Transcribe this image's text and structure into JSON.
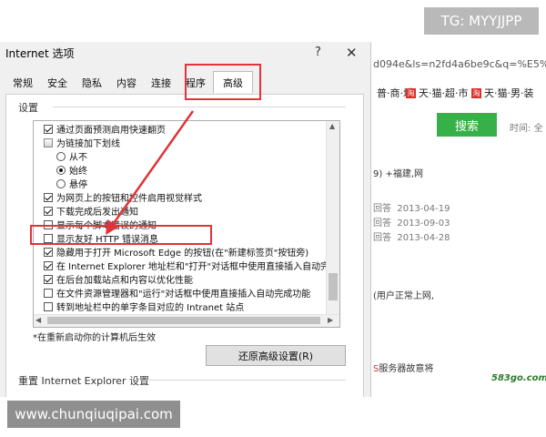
{
  "watermark_top": "TG: MYYJJPP",
  "watermark_bottom": "www.chunqiuqipai.com",
  "browser": {
    "address": "d094e&ls=n2fd4a6be9c&q=%E5%B8%",
    "bookmarks": [
      "普·商·城",
      "天·猫·超·市",
      "天·猫·男·装"
    ],
    "bookmark_badge": "淘",
    "search_button": "搜索",
    "time_label": "时间:",
    "time_value": "全",
    "result_snippet": "9) +福建,网",
    "answers": [
      {
        "label": "回答",
        "date": "2013-04-19"
      },
      {
        "label": "回答",
        "date": "2013-09-03"
      },
      {
        "label": "回答",
        "date": "2013-04-28"
      }
    ],
    "snippet2": "(用户正常上网,",
    "snippet3_prefix": "S",
    "snippet3": "服务器故意将",
    "site": "583go.com"
  },
  "dialog": {
    "title": "Internet 选项",
    "help": "?",
    "close": "✕",
    "tabs": [
      "常规",
      "安全",
      "隐私",
      "内容",
      "连接",
      "程序",
      "高级"
    ],
    "settings_label": "设置",
    "items": [
      {
        "type": "checkbox",
        "checked": true,
        "label": "通过页面预测启用快速翻页"
      },
      {
        "type": "group",
        "label": "为链接加下划线"
      },
      {
        "type": "radio",
        "checked": false,
        "label": "从不"
      },
      {
        "type": "radio",
        "checked": true,
        "label": "始终"
      },
      {
        "type": "radio",
        "checked": false,
        "label": "悬停"
      },
      {
        "type": "checkbox",
        "checked": true,
        "label": "为网页上的按钮和控件启用视觉样式"
      },
      {
        "type": "checkbox",
        "checked": true,
        "label": "下载完成后发出通知"
      },
      {
        "type": "checkbox",
        "checked": false,
        "label": "显示每个脚本错误的通知"
      },
      {
        "type": "checkbox",
        "checked": false,
        "label": "显示友好 HTTP 错误消息"
      },
      {
        "type": "checkbox",
        "checked": true,
        "label": "隐藏用于打开 Microsoft Edge 的按钮(在\"新建标签页\"按钮旁)"
      },
      {
        "type": "checkbox",
        "checked": true,
        "label": "在 Internet Explorer 地址栏和\"打开\"对话框中使用直接插入自动完"
      },
      {
        "type": "checkbox",
        "checked": true,
        "label": "在后台加载站点和内容以优化性能"
      },
      {
        "type": "checkbox",
        "checked": false,
        "label": "在文件资源管理器和\"运行\"对话框中使用直接插入自动完成功能"
      },
      {
        "type": "checkbox",
        "checked": false,
        "label": "转到地址栏中的单字条目对应的 Intranet 站点"
      }
    ],
    "note": "*在重新启动你的计算机后生效",
    "restore_button": "还原高级设置(R)",
    "reset_label": "重置 Internet Explorer 设置"
  },
  "colors": {
    "highlight": "#e0343a",
    "search_green": "#38b04a"
  }
}
